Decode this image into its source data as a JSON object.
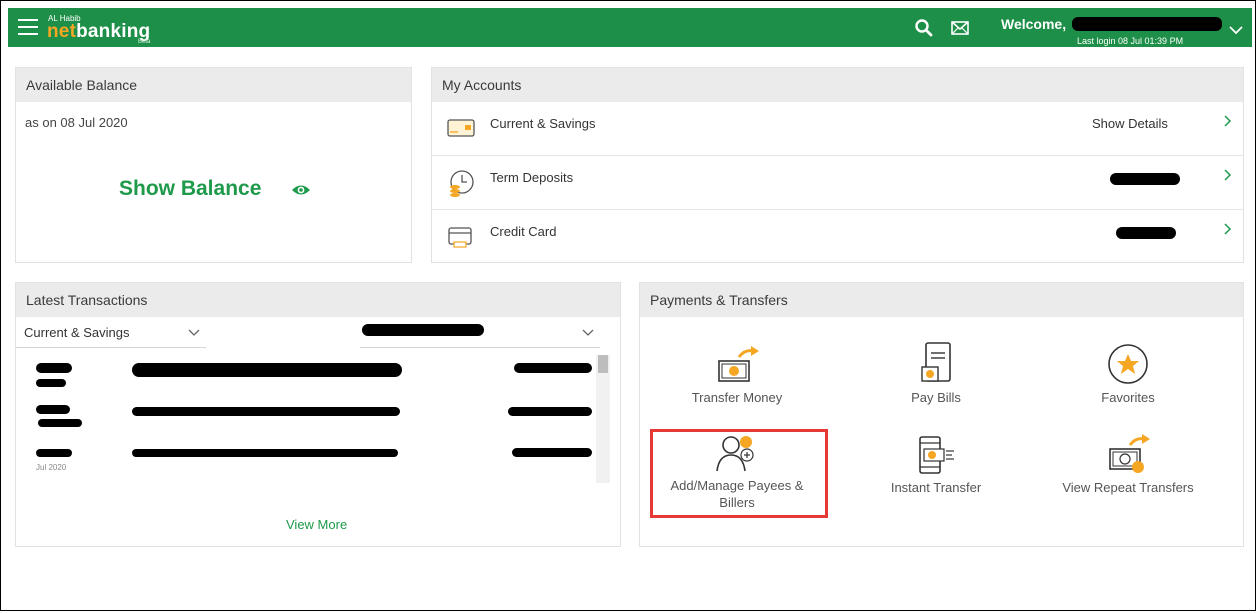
{
  "header": {
    "brand_small": "AL Habib",
    "brand_net": "net",
    "brand_banking": "banking",
    "brand_beta": "Beta",
    "welcome": "Welcome,",
    "last_login": "Last login 08 Jul 01:39 PM"
  },
  "balance": {
    "title": "Available Balance",
    "as_on": "as on 08 Jul 2020",
    "show_balance": "Show Balance"
  },
  "accounts": {
    "title": "My Accounts",
    "rows": [
      {
        "label": "Current & Savings",
        "detail": "Show Details"
      },
      {
        "label": "Term Deposits"
      },
      {
        "label": "Credit Card"
      }
    ]
  },
  "latest": {
    "title": "Latest Transactions",
    "account_select": "Current & Savings",
    "dates": [
      "Jul 2020"
    ],
    "view_more": "View More"
  },
  "payments": {
    "title": "Payments & Transfers",
    "items": [
      {
        "label": "Transfer Money",
        "icon": "transfer-money-icon"
      },
      {
        "label": "Pay Bills",
        "icon": "pay-bills-icon"
      },
      {
        "label": "Favorites",
        "icon": "star-icon"
      },
      {
        "label": "Add/Manage Payees & Billers",
        "icon": "add-payee-icon"
      },
      {
        "label": "Instant Transfer",
        "icon": "instant-transfer-icon"
      },
      {
        "label": "View Repeat Transfers",
        "icon": "repeat-transfer-icon"
      }
    ]
  },
  "colors": {
    "brand_green": "#1e8f48",
    "accent_orange": "#f5a623",
    "highlight_red": "#e53935"
  }
}
